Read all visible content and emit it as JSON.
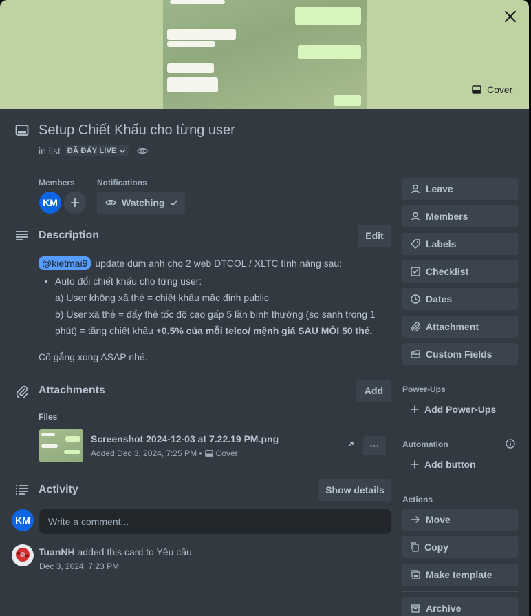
{
  "cover": {
    "button_label": "Cover"
  },
  "card": {
    "title": "Setup Chiết Khấu cho từng user",
    "in_list_prefix": "in list",
    "list_name": "ĐÃ ĐẨY LIVE"
  },
  "members": {
    "label": "Members",
    "avatar_initials": "KM"
  },
  "notifications": {
    "label": "Notifications",
    "watch_label": "Watching"
  },
  "description": {
    "heading": "Description",
    "edit_label": "Edit",
    "mention": "@kietmai9",
    "intro": "update dùm anh cho 2 web DTCOL / XLTC tính năng sau:",
    "bullet": "Auto đổi chiết khấu cho từng user:",
    "line_a": "a) User không xã thẻ = chiết khấu mặc định public",
    "line_b_part1": "b) User xã thẻ = đẩy thẻ tốc độ cao gấp 5 lần bình thường (so sánh trong 1 phút) = tăng chiết khấu ",
    "line_b_bold": "+0.5% của mỗi telco/ mệnh giá SAU MỖI 50 thẻ.",
    "closing": "Cố gắng xong ASAP nhé."
  },
  "attachments": {
    "heading": "Attachments",
    "add_label": "Add",
    "files_label": "Files",
    "file_name": "Screenshot 2024-12-03 at 7.22.19 PM.png",
    "file_added": "Added Dec 3, 2024, 7:25 PM •",
    "file_cover_label": "Cover",
    "more_label": "···"
  },
  "activity": {
    "heading": "Activity",
    "show_details_label": "Show details",
    "comment_placeholder": "Write a comment...",
    "entry_user": "TuanNH",
    "entry_text": "added this card to Yêu cầu",
    "entry_time": "Dec 3, 2024, 7:23 PM"
  },
  "sidebar": {
    "leave": "Leave",
    "members": "Members",
    "labels": "Labels",
    "checklist": "Checklist",
    "dates": "Dates",
    "attachment": "Attachment",
    "custom_fields": "Custom Fields",
    "powerups_head": "Power-Ups",
    "add_powerups": "Add Power-Ups",
    "automation_head": "Automation",
    "add_button": "Add button",
    "actions_head": "Actions",
    "move": "Move",
    "copy": "Copy",
    "make_template": "Make template",
    "archive": "Archive"
  },
  "colors": {
    "card_bg": "#323940",
    "button_bg": "#3b444c",
    "text": "#b6c2cf",
    "mention_bg": "#579dff",
    "avatar_bg": "#0c66e4",
    "cover_bg": "#bfd2a2"
  }
}
